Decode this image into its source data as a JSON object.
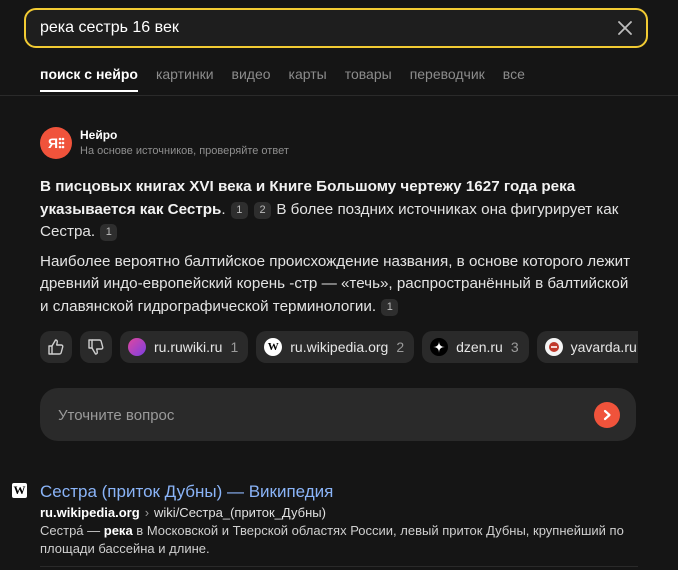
{
  "search": {
    "query": "река сестрь 16 век"
  },
  "tabs": [
    {
      "label": "поиск с нейро"
    },
    {
      "label": "картинки"
    },
    {
      "label": "видео"
    },
    {
      "label": "карты"
    },
    {
      "label": "товары"
    },
    {
      "label": "переводчик"
    },
    {
      "label": "все"
    }
  ],
  "neuro": {
    "logo_text": "Я",
    "title": "Нейро",
    "subtitle": "На основе источников, проверяйте ответ"
  },
  "answer": {
    "p1_bold": "В писцовых книгах XVI века и Книге Большому чертежу 1627 года река указывается как Сестрь",
    "p1_dot": ".",
    "p1_ref1": "1",
    "p1_ref2": "2",
    "p1_rest": "В более поздних источниках она фигурирует как Сестра.",
    "p1_ref3": "1",
    "p2_text": "Наиболее вероятно балтийское происхождение названия, в основе которого лежит древний индо-европейский корень -стр — «течь», распространённый в балтийской и славянской гидрографической терминологии.",
    "p2_ref": "1"
  },
  "sources": [
    {
      "name": "ru.ruwiki.ru",
      "count": "1",
      "icon": "ruwiki-icon",
      "color": "#8e44d6"
    },
    {
      "name": "ru.wikipedia.org",
      "count": "2",
      "icon": "wikipedia-icon",
      "color": "#ffffff"
    },
    {
      "name": "dzen.ru",
      "count": "3",
      "icon": "dzen-icon",
      "color": "#000000"
    },
    {
      "name": "yavarda.ru",
      "count": "",
      "icon": "yavarda-icon",
      "color": "#c0392b"
    }
  ],
  "followup": {
    "placeholder": "Уточните вопрос"
  },
  "result": {
    "favicon": "W",
    "title": "Сестра (приток Дубны) — Википедия",
    "domain": "ru.wikipedia.org",
    "separator": "›",
    "path": "wiki/Сестра_(приток_Дубны)",
    "snippet_start": "Сестра́ — ",
    "snippet_bold": "река",
    "snippet_rest": " в Московской и Тверской областях России, левый приток Дубны, крупнейший по площади бассейна и длине."
  },
  "colors": {
    "accent": "#f2cb33",
    "brand": "#f0533b",
    "link": "#8ab4f8"
  }
}
